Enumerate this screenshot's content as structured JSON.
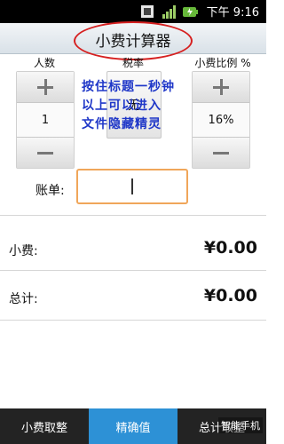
{
  "status_bar": {
    "time_prefix": "下午",
    "time": "9:16",
    "icons": [
      "sim-icon",
      "signal-icon",
      "battery-icon"
    ]
  },
  "header": {
    "title": "小费计算器"
  },
  "labels": {
    "people": "人数",
    "tax_rate": "税率",
    "tip_percent": "小费比例 %"
  },
  "people": {
    "value": "1"
  },
  "tax": {
    "value": "无"
  },
  "tip_percent": {
    "value": "16%"
  },
  "overlay_text": [
    "按住标题一秒钟",
    "以上可以进入",
    "文件隐藏精灵"
  ],
  "bill": {
    "label": "账单:",
    "value": ""
  },
  "results": {
    "tip_label": "小费:",
    "tip_value": "¥0.00",
    "total_label": "总计:",
    "total_value": "¥0.00"
  },
  "tabs": [
    {
      "label": "小费取整",
      "active": false
    },
    {
      "label": "精确值",
      "active": true
    },
    {
      "label": "总计取整",
      "active": false
    }
  ],
  "watermark": "智能手机",
  "colors": {
    "accent": "#2d91d6",
    "highlight_ring": "#d62020",
    "input_border": "#f0a65a",
    "overlay_text": "#1f37c8"
  }
}
